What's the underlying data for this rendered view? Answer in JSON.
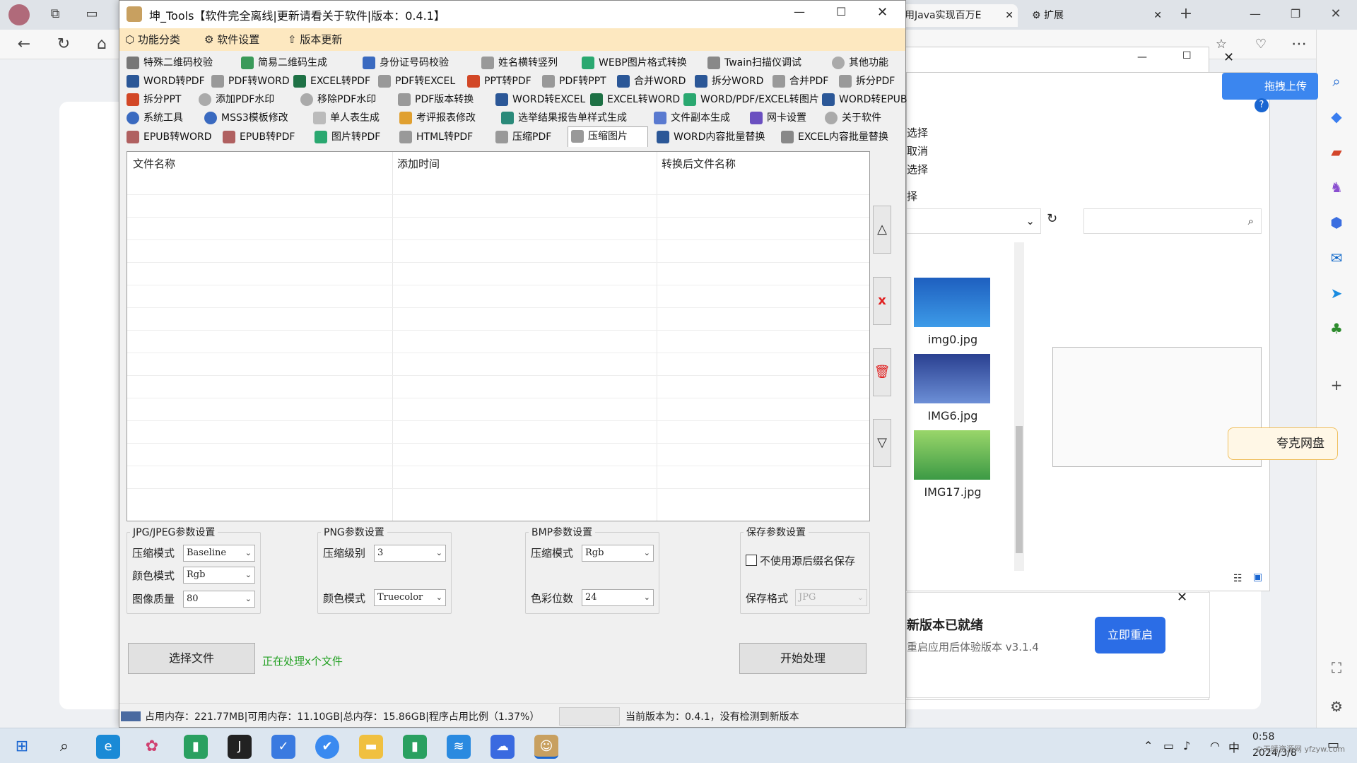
{
  "browser": {
    "tabs": [
      "用Java实现百万E",
      "扩展"
    ],
    "notify": {
      "title": "新版本已就绪",
      "sub": "重启应用后体验版本 v3.1.4",
      "button": "立即重启"
    },
    "quark_label": "夸克网盘",
    "upload_label": "拖拽上传"
  },
  "explorer": {
    "side_items": [
      "选择",
      "取消",
      "选择",
      "择"
    ],
    "files": [
      {
        "name": "img0.jpg",
        "color": "#2b7fd6"
      },
      {
        "name": "IMG6.jpg",
        "color": "#2b4fa8"
      },
      {
        "name": "IMG17.jpg",
        "color": "#6cc06a"
      }
    ]
  },
  "app": {
    "title": "坤_Tools【软件完全离线|更新请看关于软件|版本：0.4.1】",
    "menu": [
      "功能分类",
      "软件设置",
      "版本更新"
    ],
    "tab_rows": [
      [
        "特殊二维码校验",
        "简易二维码生成",
        "身份证号码校验",
        "姓名横转竖列",
        "WEBP图片格式转换",
        "Twain扫描仪调试",
        "其他功能"
      ],
      [
        "WORD转PDF",
        "PDF转WORD",
        "EXCEL转PDF",
        "PDF转EXCEL",
        "PPT转PDF",
        "PDF转PPT",
        "合并WORD",
        "拆分WORD",
        "合并PDF",
        "拆分PDF"
      ],
      [
        "拆分PPT",
        "添加PDF水印",
        "移除PDF水印",
        "PDF版本转换",
        "WORD转EXCEL",
        "EXCEL转WORD",
        "WORD/PDF/EXCEL转图片",
        "WORD转EPUB"
      ],
      [
        "系统工具",
        "MSS3模板修改",
        "单人表生成",
        "考评报表修改",
        "选举结果报告单样式生成",
        "文件副本生成",
        "网卡设置",
        "关于软件"
      ],
      [
        "EPUB转WORD",
        "EPUB转PDF",
        "图片转PDF",
        "HTML转PDF",
        "压缩PDF",
        "压缩图片",
        "WORD内容批量替换",
        "EXCEL内容批量替换"
      ]
    ],
    "active_tab": "压缩图片",
    "columns": [
      "文件名称",
      "添加时间",
      "转换后文件名称"
    ],
    "jpg": {
      "legend": "JPG/JPEG参数设置",
      "mode_label": "压缩模式",
      "mode": "Baseline",
      "color_label": "颜色模式",
      "color": "Rgb",
      "quality_label": "图像质量",
      "quality": "80"
    },
    "png": {
      "legend": "PNG参数设置",
      "level_label": "压缩级别",
      "level": "3",
      "color_label": "颜色模式",
      "color": "Truecolor"
    },
    "bmp": {
      "legend": "BMP参数设置",
      "mode_label": "压缩模式",
      "mode": "Rgb",
      "bits_label": "色彩位数",
      "bits": "24"
    },
    "save": {
      "legend": "保存参数设置",
      "checkbox": "不使用源后缀名保存",
      "format_label": "保存格式",
      "format": "JPG"
    },
    "select_button": "选择文件",
    "processing": "正在处理x个文件",
    "start_button": "开始处理",
    "status_mem": "占用内存：221.77MB|可用内存：11.10GB|总内存：15.86GB|程序占用比例（1.37%）",
    "status_ver": "当前版本为：0.4.1，没有检测到新版本"
  },
  "taskbar": {
    "time": "0:58",
    "date": "2024/3/8",
    "ime": "中",
    "watermark": "©天晴资源网 yfzyw.com"
  }
}
